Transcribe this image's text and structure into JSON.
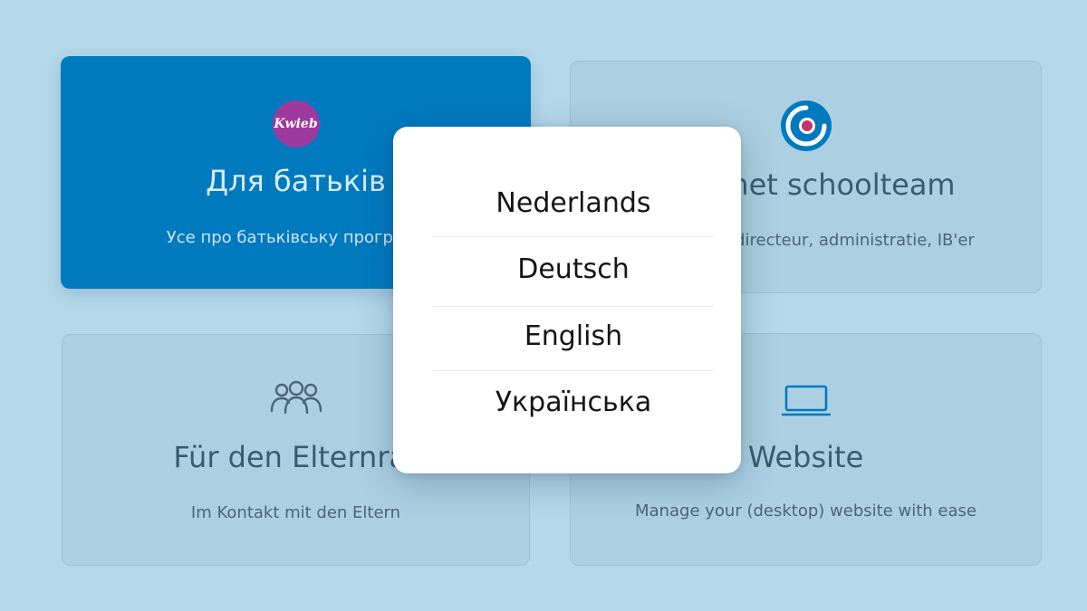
{
  "cards": [
    {
      "title": "Для батьків",
      "subtitle": "Усе про батьківську програму",
      "icon": "kwieb-logo",
      "logo_text": "Kwieb",
      "color": "#007abf",
      "state": "highlighted"
    },
    {
      "title": "Voor het schoolteam",
      "subtitle": "Leerkracht, directeur, administratie, IB'er",
      "icon": "target-logo-icon"
    },
    {
      "title": "Für den Elternrat",
      "subtitle": "Im Kontakt mit den Eltern",
      "icon": "group-icon"
    },
    {
      "title": "Website",
      "subtitle": "Manage your (desktop) website with ease",
      "icon": "laptop-icon"
    }
  ],
  "language_menu": {
    "options": [
      "Nederlands",
      "Deutsch",
      "English",
      "Українська"
    ]
  },
  "colors": {
    "background": "#b5d8ea",
    "card": "#acd0e2",
    "primary": "#007abf",
    "logo_accent": "#c0336c",
    "kwieb": "#9e3a9f"
  }
}
